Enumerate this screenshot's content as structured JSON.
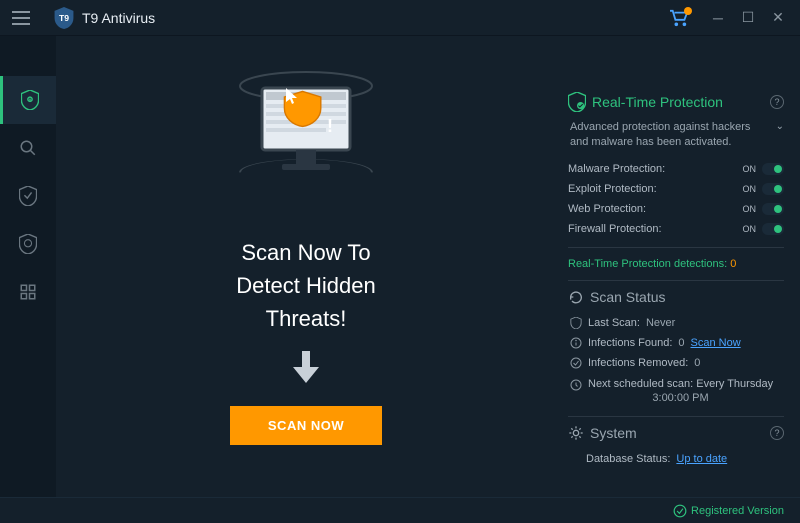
{
  "app": {
    "title": "T9 Antivirus"
  },
  "center": {
    "heading_l1": "Scan Now To",
    "heading_l2": "Detect Hidden",
    "heading_l3": "Threats!",
    "scan_button": "SCAN NOW"
  },
  "realtime": {
    "title": "Real-Time Protection",
    "advanced_msg": "Advanced protection against hackers and malware has been activated.",
    "items": [
      {
        "label": "Malware Protection:",
        "state": "ON"
      },
      {
        "label": "Exploit Protection:",
        "state": "ON"
      },
      {
        "label": "Web Protection:",
        "state": "ON"
      },
      {
        "label": "Firewall Protection:",
        "state": "ON"
      }
    ],
    "detections_label": "Real-Time Protection detections:",
    "detections_count": "0"
  },
  "scan_status": {
    "title": "Scan Status",
    "last_scan_label": "Last Scan:",
    "last_scan_value": "Never",
    "infections_found_label": "Infections Found:",
    "infections_found_value": "0",
    "scan_now_link": "Scan Now",
    "infections_removed_label": "Infections Removed:",
    "infections_removed_value": "0",
    "next_scan_label": "Next scheduled scan:",
    "next_scan_value": "Every Thursday",
    "next_scan_time": "3:00:00 PM"
  },
  "system": {
    "title": "System",
    "db_status_label": "Database Status:",
    "db_status_value": "Up to date"
  },
  "footer": {
    "text": "Registered Version"
  }
}
